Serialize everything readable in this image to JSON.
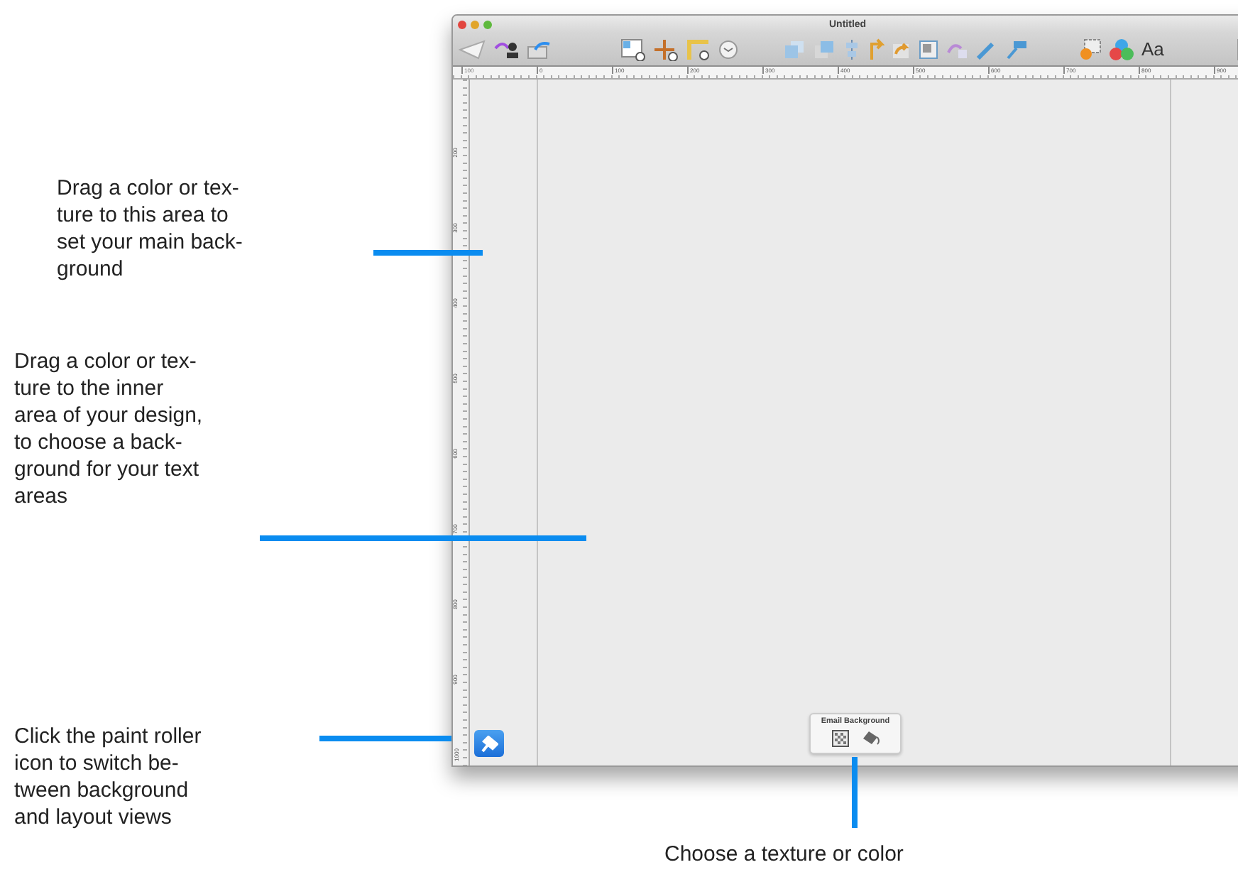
{
  "window": {
    "title": "Untitled"
  },
  "toolbar": {
    "font_label": "Aa"
  },
  "rulers": {
    "horizontal": [
      "100",
      "0",
      "100",
      "200",
      "300",
      "400",
      "500",
      "600",
      "700",
      "800",
      "900"
    ],
    "vertical": [
      "200",
      "300",
      "400",
      "500",
      "600",
      "700",
      "800",
      "900",
      "1000"
    ]
  },
  "background_panel": {
    "title": "Email Background"
  },
  "callouts": [
    {
      "kind": "left",
      "lines": [
        "Drag a color or tex-",
        "ture to this area to",
        "set your main back-",
        "ground"
      ]
    },
    {
      "kind": "left",
      "lines": [
        "Drag a color or tex-",
        "ture to the inner",
        "area of your design,",
        "to choose a back-",
        "ground for your text",
        "areas"
      ]
    },
    {
      "kind": "left",
      "lines": [
        "Click the paint roller",
        "icon to switch be-",
        "tween background",
        "and layout views"
      ]
    },
    {
      "kind": "bottom",
      "lines": [
        "Choose a texture or color"
      ]
    }
  ]
}
